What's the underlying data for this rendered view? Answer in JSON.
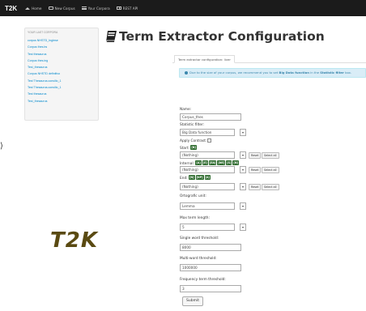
{
  "nav": {
    "brand": "T2K",
    "items": [
      {
        "label": "Home",
        "icon": "home-icon"
      },
      {
        "label": "New Corpus",
        "icon": "book-icon"
      },
      {
        "label": "Your Corpora",
        "icon": "list-icon"
      },
      {
        "label": "REST API",
        "icon": "grid-icon"
      }
    ]
  },
  "sidebar": {
    "title": "YOUR LAST CORPORA",
    "items": [
      "corpus NHSTD_Inglese",
      "Corpus thes.bs",
      "Test thesaurus",
      "Corpus thes.ing",
      "Test_thesaurus",
      "Corpus NHSTD definitivo",
      "Test Thesaurus.consilio_1",
      "Test Thesaurus.consilio_1",
      "Test thesaurus",
      "Test_thesaurus"
    ]
  },
  "logo_text": "T2K",
  "page_title": "Term Extractor Configuration",
  "tab_label": "Term extractor configuration: liver",
  "alert": {
    "prefix": "Due to the size of your corpus, we recommend you to set",
    "highlight": "Big Data function",
    "middle": "in the",
    "highlight2": "Statistic filter",
    "suffix": "box."
  },
  "form": {
    "name_label": "Name:",
    "name_value": "Corpus_thes",
    "stat_label": "Statistic filter:",
    "stat_value": "Big Data function",
    "contrast_label": "Apply Contrast:",
    "start_label": "Start:",
    "start_tags": [
      "[N]"
    ],
    "start_value": "(Nothing)",
    "internal_label": "Internal:",
    "internal_tags": [
      "[A]",
      "[E]",
      "[EA]",
      "[NE]",
      "[S]",
      "[N]"
    ],
    "internal_value": "(Nothing)",
    "end_label": "End:",
    "end_tags": [
      "[N]",
      "[NP]",
      "[A]"
    ],
    "end_value": "(Nothing)",
    "reset_label": "Reset",
    "select_all_label": "Select all",
    "ortho_label": "Ortografic unit:",
    "ortho_value": "Lemma",
    "max_label": "Max term length:",
    "max_value": "5",
    "single_label": "Single word threshold:",
    "single_value": "8000",
    "multi_label": "Multi-word threshold:",
    "multi_value": "1000000",
    "freq_label": "Frequency term threshold:",
    "freq_value": "3",
    "submit_label": "Submit"
  },
  "colors": {
    "nav_bg": "#1b1b1b",
    "link": "#0088cc",
    "tag_bg": "#2e6b2e",
    "alert_bg": "#d9edf7",
    "alert_text": "#3a87ad",
    "logo": "#5a4a12"
  }
}
